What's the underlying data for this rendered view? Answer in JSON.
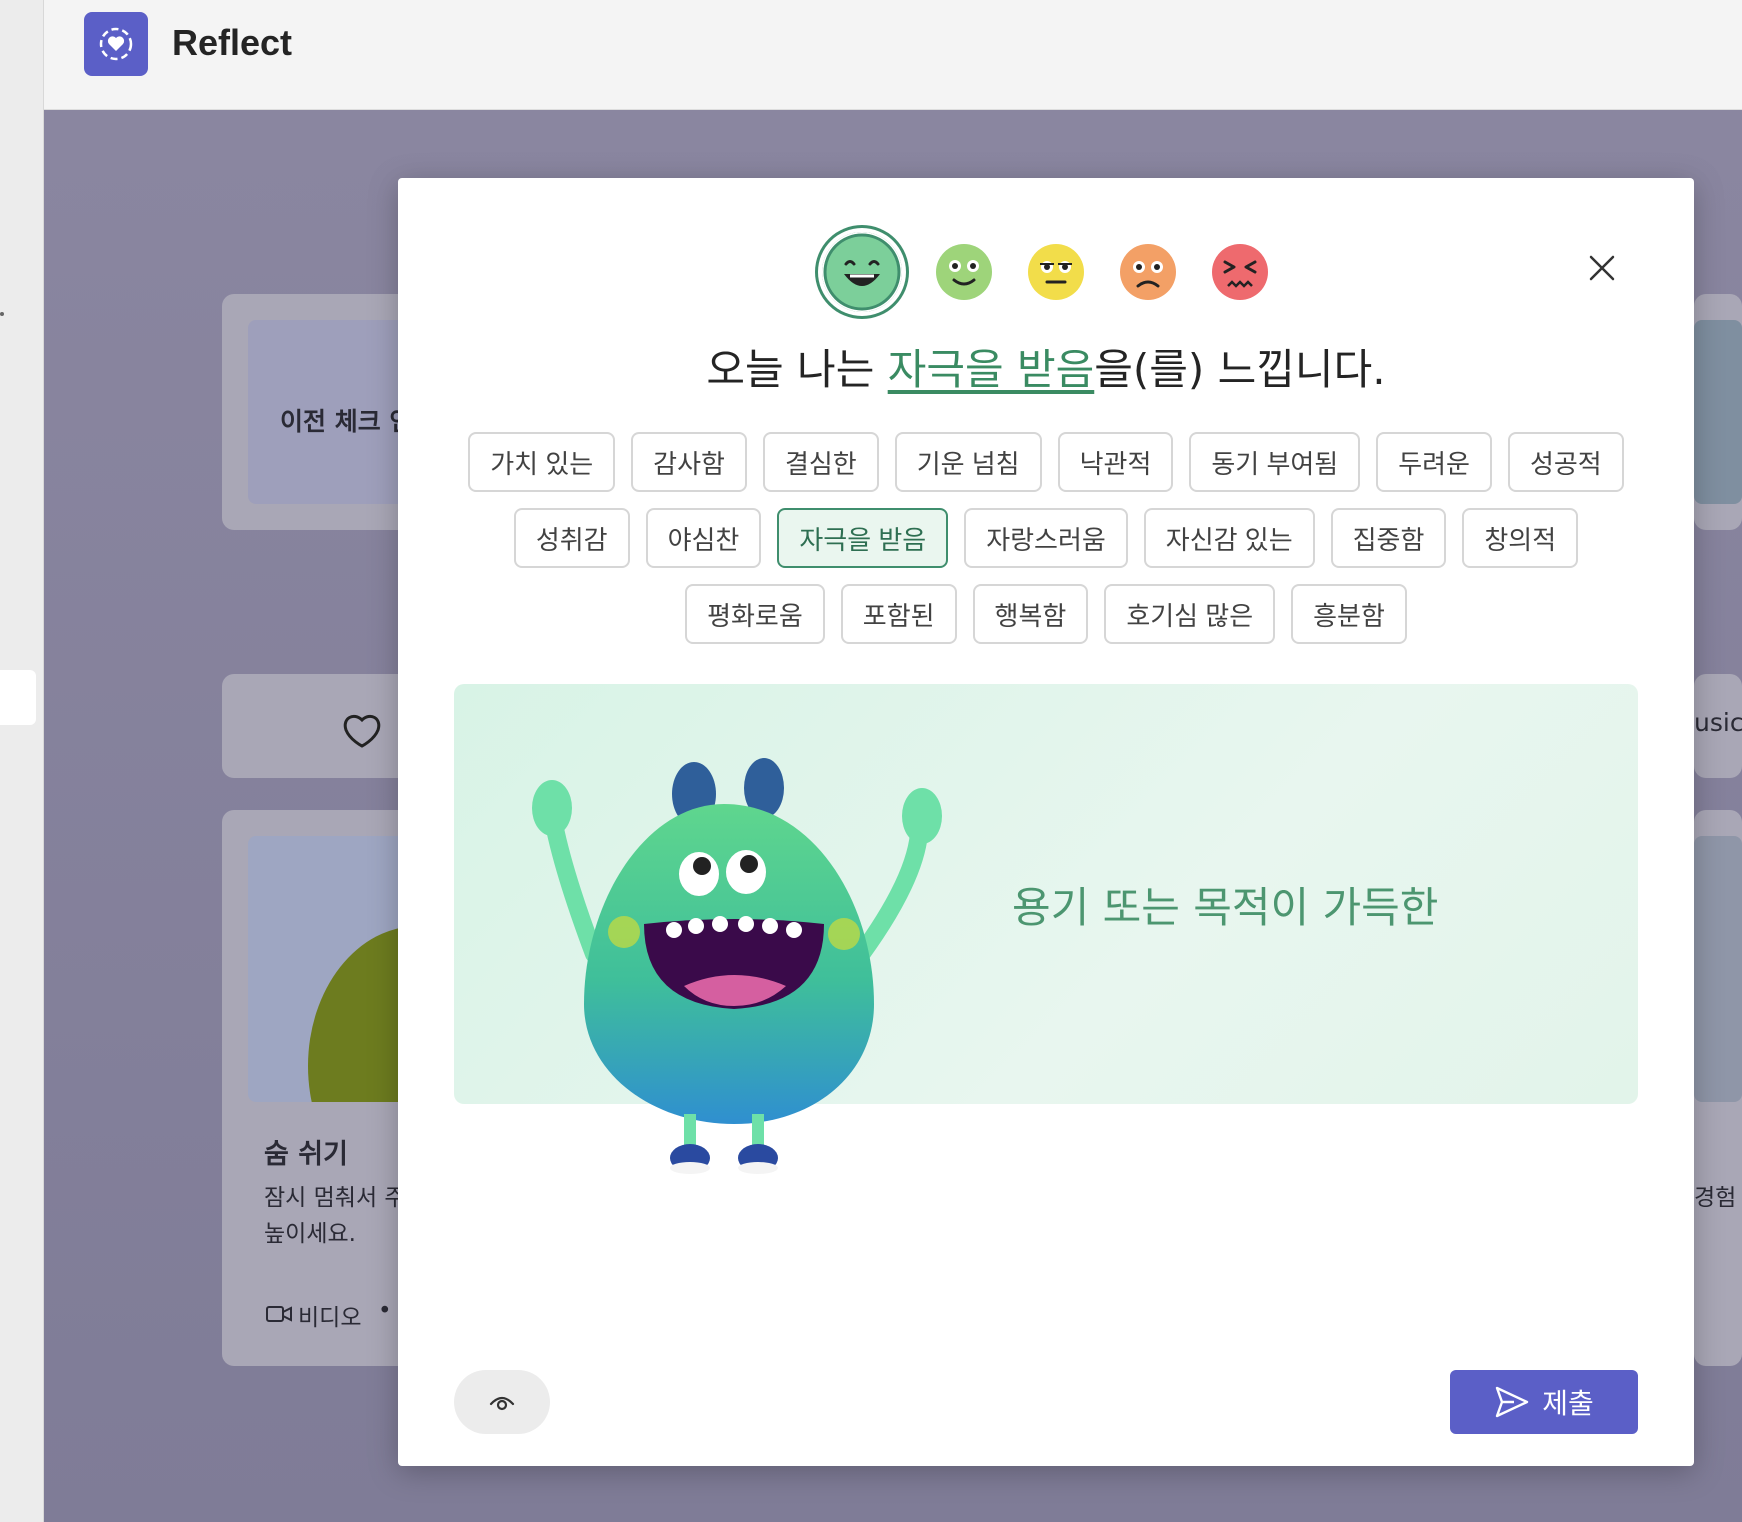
{
  "app": {
    "title": "Reflect",
    "icon": "heart-ring-icon",
    "accent": "#5b5fc7"
  },
  "background": {
    "card1_text": "이전 체크 인",
    "card2_text": "usic",
    "card3_title": "숨 쉬기",
    "card3_desc_line1": "잠시 멈춰서 주",
    "card3_desc_line2": "높이세요.",
    "card3_meta": "비디오",
    "card3_meta_dot": "•",
    "card4_text": "경험"
  },
  "dialog": {
    "emojis": [
      {
        "name": "very-happy-emoji",
        "color": "#7ccf9a",
        "selected": true
      },
      {
        "name": "slightly-happy-emoji",
        "color": "#9ed47a",
        "selected": false
      },
      {
        "name": "neutral-emoji",
        "color": "#f2dd4a",
        "selected": false
      },
      {
        "name": "sad-emoji",
        "color": "#f3a066",
        "selected": false
      },
      {
        "name": "upset-emoji",
        "color": "#ee6a6e",
        "selected": false
      }
    ],
    "question_prefix": "오늘 나는 ",
    "question_highlight": "자극을 받음",
    "question_suffix": "을(를) 느낍니다.",
    "chips": [
      "가치 있는",
      "감사함",
      "결심한",
      "기운 넘침",
      "낙관적",
      "동기 부여됨",
      "두려운",
      "성공적",
      "성취감",
      "야심찬",
      "자극을 받음",
      "자랑스러움",
      "자신감 있는",
      "집중함",
      "창의적",
      "평화로움",
      "포함된",
      "행복함",
      "호기심 많은",
      "흥분함"
    ],
    "selected_chip": "자극을 받음",
    "feeling_description": "용기 또는 목적이 가득한",
    "submit_label": "제출",
    "selected_color": "#3f8e6d"
  }
}
